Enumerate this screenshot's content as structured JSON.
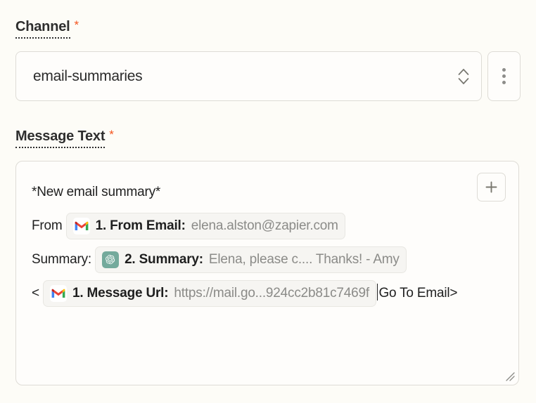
{
  "form": {
    "channel": {
      "label": "Channel",
      "required_marker": "*",
      "selected_value": "email-summaries",
      "dropdown_icon": "chevron-up-down-icon",
      "overflow_icon": "kebab-menu-icon"
    },
    "message_text": {
      "label": "Message Text",
      "required_marker": "*",
      "add_field_icon": "plus-icon",
      "resize_icon": "resize-grip-icon",
      "content": {
        "line1": "*New email summary*",
        "from_prefix": "From ",
        "summary_prefix": "Summary:",
        "url_open_bracket": "<",
        "link_text": "Go To Email>"
      },
      "tokens": [
        {
          "id": "from-email",
          "app_icon": "gmail-icon",
          "label": "1. From Email:",
          "value": "elena.alston@zapier.com"
        },
        {
          "id": "summary",
          "app_icon": "openai-icon",
          "label": "2. Summary:",
          "value": "Elena, please c.... Thanks! - Amy"
        },
        {
          "id": "message-url",
          "app_icon": "gmail-icon",
          "label": "1. Message Url:",
          "value": "https://mail.go...924cc2b81c7469f"
        }
      ]
    }
  },
  "colors": {
    "background": "#fdfcf7",
    "field_surface": "#fefdfb",
    "border": "#dedcd6",
    "required_asterisk": "#f4541e",
    "token_background": "#f6f5f2",
    "token_value_text": "#8b8b88",
    "text_primary": "#1f1f1f",
    "openai_green": "#74aa9c"
  }
}
